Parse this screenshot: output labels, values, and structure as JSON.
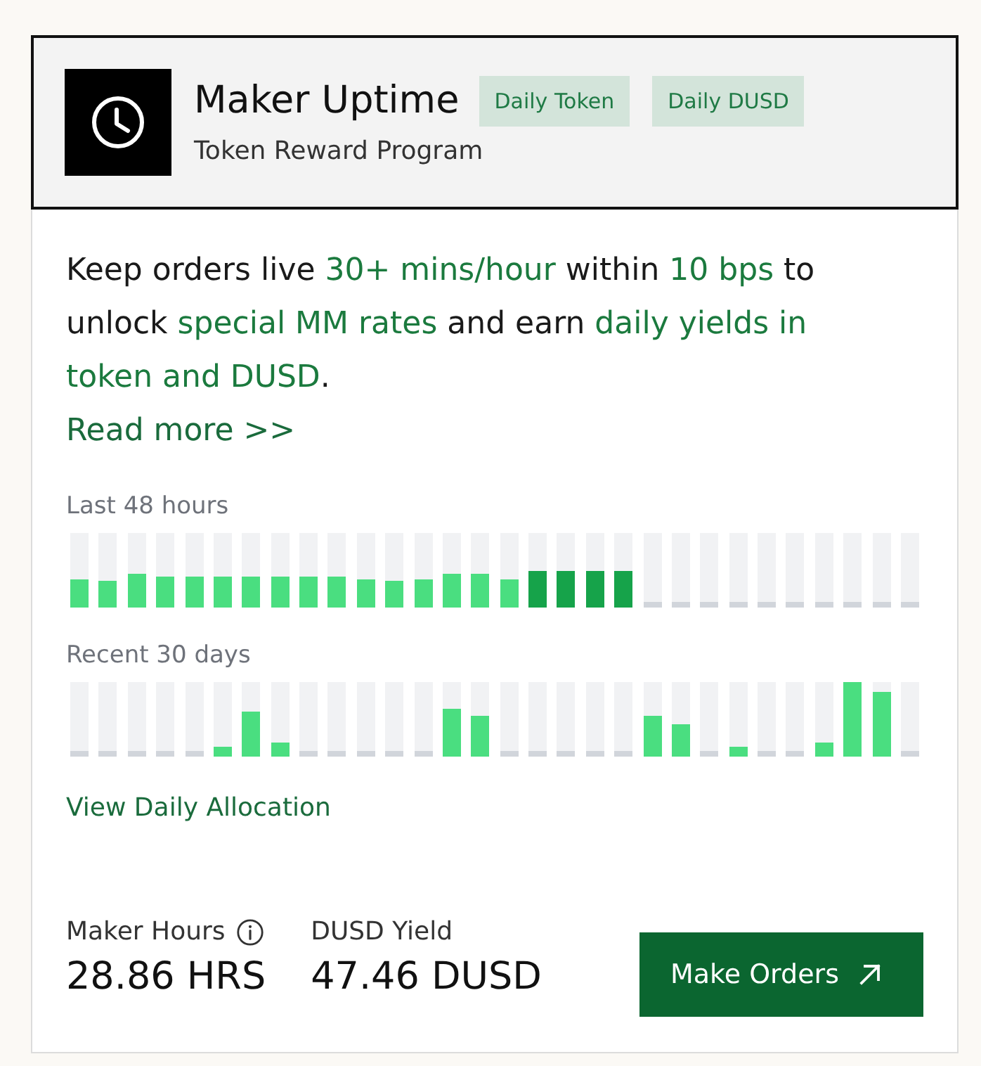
{
  "header": {
    "title": "Maker Uptime",
    "tags": [
      "Daily Token",
      "Daily DUSD"
    ],
    "subtitle": "Token Reward Program"
  },
  "description": [
    {
      "text": "Keep orders live ",
      "highlight": false
    },
    {
      "text": "30+ mins/hour",
      "highlight": true
    },
    {
      "text": " within ",
      "highlight": false
    },
    {
      "text": "10 bps",
      "highlight": true
    },
    {
      "text": " to unlock ",
      "highlight": false
    },
    {
      "text": "special MM rates",
      "highlight": true
    },
    {
      "text": " and earn ",
      "highlight": false
    },
    {
      "text": "daily yields in token and DUSD",
      "highlight": true
    },
    {
      "text": ".",
      "highlight": false
    }
  ],
  "read_more": "Read more >>",
  "uptime_charts": [
    {
      "label": "Last 48 hours",
      "bars": [
        {
          "level": 0.38,
          "color": "#4ade80"
        },
        {
          "level": 0.35,
          "color": "#4ade80"
        },
        {
          "level": 0.46,
          "color": "#4ade80"
        },
        {
          "level": 0.42,
          "color": "#4ade80"
        },
        {
          "level": 0.42,
          "color": "#4ade80"
        },
        {
          "level": 0.42,
          "color": "#4ade80"
        },
        {
          "level": 0.42,
          "color": "#4ade80"
        },
        {
          "level": 0.42,
          "color": "#4ade80"
        },
        {
          "level": 0.42,
          "color": "#4ade80"
        },
        {
          "level": 0.42,
          "color": "#4ade80"
        },
        {
          "level": 0.38,
          "color": "#4ade80"
        },
        {
          "level": 0.35,
          "color": "#4ade80"
        },
        {
          "level": 0.38,
          "color": "#4ade80"
        },
        {
          "level": 0.46,
          "color": "#4ade80"
        },
        {
          "level": 0.46,
          "color": "#4ade80"
        },
        {
          "level": 0.38,
          "color": "#4ade80"
        },
        {
          "level": 0.5,
          "color": "#16a34a"
        },
        {
          "level": 0.5,
          "color": "#16a34a"
        },
        {
          "level": 0.5,
          "color": "#16a34a"
        },
        {
          "level": 0.5,
          "color": "#16a34a"
        },
        {
          "level": 0
        },
        {
          "level": 0
        },
        {
          "level": 0
        },
        {
          "level": 0
        },
        {
          "level": 0
        },
        {
          "level": 0
        },
        {
          "level": 0
        },
        {
          "level": 0
        },
        {
          "level": 0
        },
        {
          "level": 0
        }
      ]
    },
    {
      "label": "Recent 30 days",
      "bars": [
        {
          "level": 0
        },
        {
          "level": 0
        },
        {
          "level": 0
        },
        {
          "level": 0
        },
        {
          "level": 0
        },
        {
          "level": 0.14,
          "color": "#4ade80"
        },
        {
          "level": 0.61,
          "color": "#4ade80"
        },
        {
          "level": 0.18,
          "color": "#4ade80"
        },
        {
          "level": 0
        },
        {
          "level": 0
        },
        {
          "level": 0
        },
        {
          "level": 0
        },
        {
          "level": 0
        },
        {
          "level": 0.65,
          "color": "#4ade80"
        },
        {
          "level": 0.54,
          "color": "#4ade80"
        },
        {
          "level": 0
        },
        {
          "level": 0
        },
        {
          "level": 0
        },
        {
          "level": 0
        },
        {
          "level": 0
        },
        {
          "level": 0.54,
          "color": "#4ade80"
        },
        {
          "level": 0.43,
          "color": "#4ade80"
        },
        {
          "level": 0
        },
        {
          "level": 0.14,
          "color": "#4ade80"
        },
        {
          "level": 0
        },
        {
          "level": 0
        },
        {
          "level": 0.18,
          "color": "#4ade80"
        },
        {
          "level": 1,
          "color": "#4ade80"
        },
        {
          "level": 0.87,
          "color": "#4ade80"
        },
        {
          "level": 0
        }
      ]
    }
  ],
  "allocation_link": "View Daily Allocation",
  "stats": [
    {
      "label": "Maker Hours",
      "value": "28.86 HRS",
      "info": true
    },
    {
      "label": "DUSD Yield",
      "value": "47.46 DUSD",
      "info": false
    }
  ],
  "action_button": "Make Orders"
}
